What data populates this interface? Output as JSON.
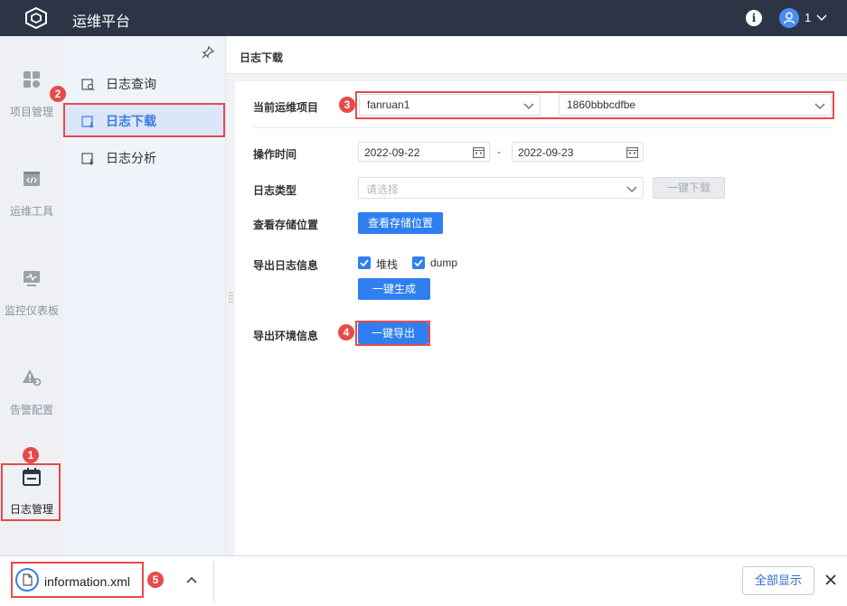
{
  "app": {
    "title": "运维平台",
    "user": "1"
  },
  "nav": {
    "items": [
      {
        "label": "项目管理",
        "icon": "grid-icon"
      },
      {
        "label": "运维工具",
        "icon": "code-window-icon"
      },
      {
        "label": "监控仪表板",
        "icon": "monitor-icon"
      },
      {
        "label": "告警配置",
        "icon": "alert-gear-icon"
      },
      {
        "label": "日志管理",
        "icon": "calendar-log-icon"
      }
    ]
  },
  "submenu": {
    "items": [
      {
        "label": "日志查询",
        "icon": "log-search-icon"
      },
      {
        "label": "日志下载",
        "icon": "log-download-icon"
      },
      {
        "label": "日志分析",
        "icon": "log-analysis-icon"
      }
    ]
  },
  "page": {
    "title": "日志下载"
  },
  "form": {
    "project_label": "当前运维项目",
    "project_value": "fanruan1",
    "project_id": "1860bbbcdfbe",
    "time_label": "操作时间",
    "date_start": "2022-09-22",
    "date_sep": "-",
    "date_end": "2022-09-23",
    "type_label": "日志类型",
    "type_placeholder": "请选择",
    "download_btn": "一键下载",
    "storage_label": "查看存储位置",
    "storage_btn": "查看存储位置",
    "export_log_label": "导出日志信息",
    "cb_stack": "堆栈",
    "cb_dump": "dump",
    "generate_btn": "一键生成",
    "export_env_label": "导出环境信息",
    "export_btn": "一键导出"
  },
  "badges": [
    "1",
    "2",
    "3",
    "4",
    "5"
  ],
  "download_bar": {
    "filename": "information.xml",
    "show_all": "全部显示"
  },
  "colors": {
    "accent": "#2f7ff0",
    "highlight": "#e74a4a",
    "topbar": "#2c3545"
  }
}
